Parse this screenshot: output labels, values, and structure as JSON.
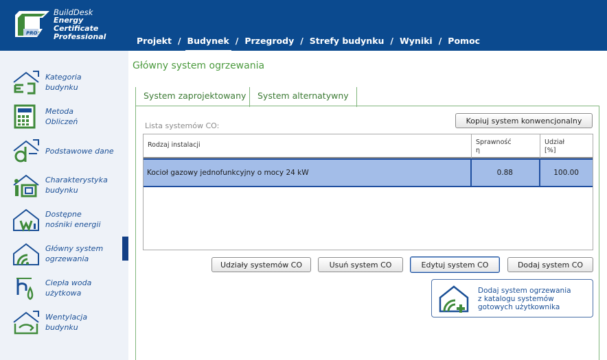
{
  "brand": {
    "line1": "BuildDesk",
    "line2": "Energy",
    "line3": "Certificate",
    "line4": "Professional",
    "badge": "PRO"
  },
  "nav": {
    "items": [
      {
        "label": "Projekt"
      },
      {
        "label": "Budynek"
      },
      {
        "label": "Przegrody"
      },
      {
        "label": "Strefy budynku"
      },
      {
        "label": "Wyniki"
      },
      {
        "label": "Pomoc"
      }
    ],
    "separator": "/"
  },
  "sidebar": {
    "items": [
      {
        "label": "Kategoria\nbudynku",
        "icon": "category-icon"
      },
      {
        "label": "Metoda\nObliczeń",
        "icon": "calculator-icon"
      },
      {
        "label": "Podstawowe dane",
        "icon": "basic-data-icon"
      },
      {
        "label": "Charakterystyka\nbudynku",
        "icon": "building-info-icon"
      },
      {
        "label": "Dostępne\nnośniki energii",
        "icon": "energy-carriers-icon"
      },
      {
        "label": "Główny system\nogrzewania",
        "icon": "heating-icon"
      },
      {
        "label": "Ciepła woda\nużytkowa",
        "icon": "hot-water-icon"
      },
      {
        "label": "Wentylacja\nbudynku",
        "icon": "ventilation-icon"
      }
    ]
  },
  "page": {
    "title": "Główny system ogrzewania"
  },
  "tabs": [
    {
      "label": "System zaprojektowany"
    },
    {
      "label": "System alternatywny"
    }
  ],
  "list": {
    "label": "Lista systemów CO:",
    "copy_button": "Kopiuj system konwencjonalny",
    "columns": [
      {
        "label": "Rodzaj instalacji"
      },
      {
        "label": "Sprawność\nη"
      },
      {
        "label": "Udział\n[%]"
      }
    ],
    "rows": [
      {
        "type": "Kocioł gazowy jednofunkcyjny o mocy 24 kW",
        "efficiency": "0.88",
        "share": "100.00"
      }
    ]
  },
  "actions": {
    "shares": "Udziały systemów CO",
    "remove": "Usuń system CO",
    "edit": "Edytuj system CO",
    "add": "Dodaj system CO"
  },
  "catalog": {
    "label": "Dodaj system ogrzewania\nz katalogu systemów\ngotowych użytkownika"
  },
  "colors": {
    "header": "#0b4a8f",
    "accent_green": "#4b9a3e",
    "selection": "#a3bde8",
    "sidebar_text": "#1a4f96"
  }
}
